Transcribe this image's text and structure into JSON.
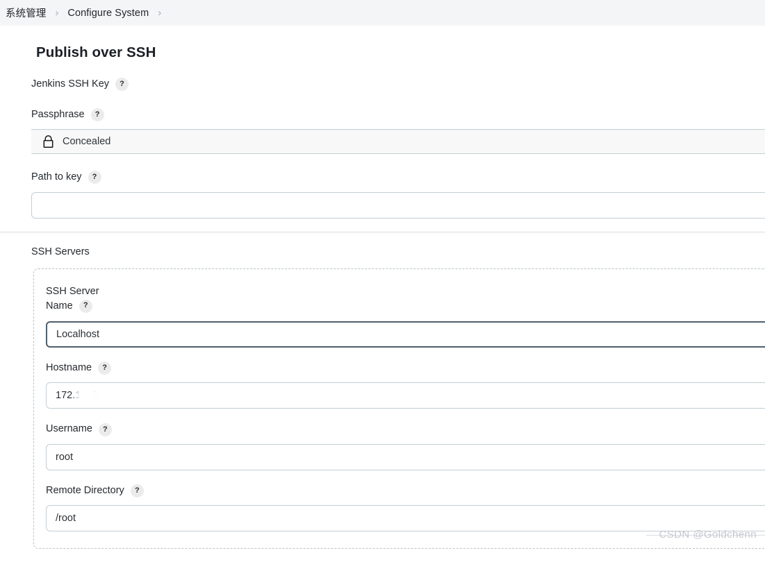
{
  "breadcrumb": {
    "items": [
      {
        "label": "系统管理",
        "name": "breadcrumb-item-system-management"
      },
      {
        "label": "Configure System",
        "name": "breadcrumb-item-configure-system"
      }
    ],
    "separator": "›"
  },
  "page": {
    "title": "Publish over SSH"
  },
  "help": {
    "glyph": "?"
  },
  "fields": {
    "jenkins_ssh_key": {
      "label": "Jenkins SSH Key"
    },
    "passphrase": {
      "label": "Passphrase",
      "value": "Concealed",
      "icon": "lock-icon"
    },
    "path_to_key": {
      "label": "Path to key",
      "value": "",
      "placeholder": ""
    }
  },
  "ssh_servers": {
    "label": "SSH Servers",
    "server": {
      "heading": "SSH Server",
      "name_label": "Name",
      "name_value": "Localhost",
      "hostname_label": "Hostname",
      "hostname_value": "172.1   .6",
      "username_label": "Username",
      "username_value": "root",
      "remote_directory_label": "Remote Directory",
      "remote_directory_value": "/root"
    }
  },
  "watermark": {
    "text": "CSDN @Goldchenn"
  },
  "colors": {
    "breadcrumb_bg": "#f4f5f7",
    "input_border": "#c3ced4",
    "input_border_focused": "#4e5f6c",
    "help_badge_bg": "#ebebeb",
    "dashed_border": "#b9c2c9",
    "watermark": "#c3c8cf"
  }
}
